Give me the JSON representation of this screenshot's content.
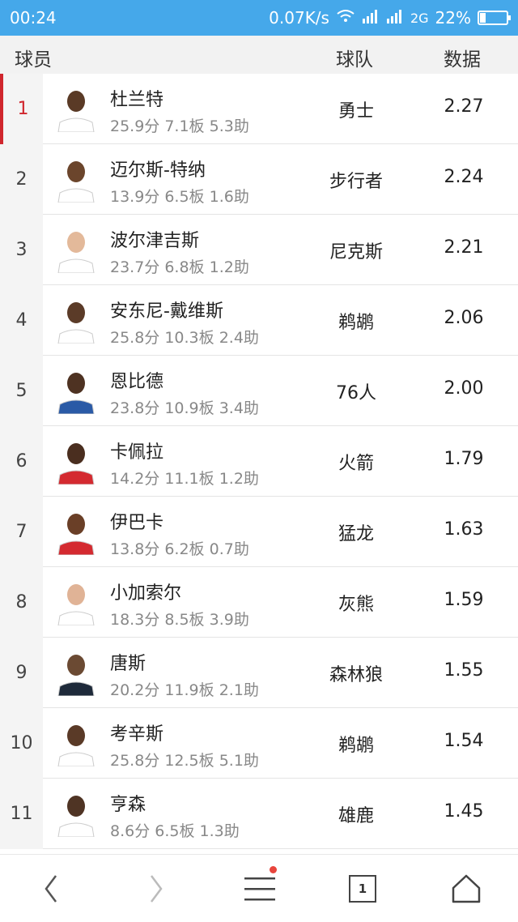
{
  "status": {
    "time": "00:24",
    "speed": "0.07K/s",
    "network": "2G",
    "battery": "22%",
    "battery_level": 0.22
  },
  "header": {
    "player": "球员",
    "team": "球队",
    "value": "数据"
  },
  "rows": [
    {
      "rank": "1",
      "name": "杜兰特",
      "stats": "25.9分 7.1板 5.3助",
      "team": "勇士",
      "value": "2.27",
      "jersey": "#ffffff",
      "skin": "#5a3a26"
    },
    {
      "rank": "2",
      "name": "迈尔斯-特纳",
      "stats": "13.9分 6.5板 1.6助",
      "team": "步行者",
      "value": "2.24",
      "jersey": "#ffffff",
      "skin": "#6b452c"
    },
    {
      "rank": "3",
      "name": "波尔津吉斯",
      "stats": "23.7分 6.8板 1.2助",
      "team": "尼克斯",
      "value": "2.21",
      "jersey": "#ffffff",
      "skin": "#e3b99a"
    },
    {
      "rank": "4",
      "name": "安东尼-戴维斯",
      "stats": "25.8分 10.3板 2.4助",
      "team": "鹈鹕",
      "value": "2.06",
      "jersey": "#ffffff",
      "skin": "#5b3b28"
    },
    {
      "rank": "5",
      "name": "恩比德",
      "stats": "23.8分 10.9板 3.4助",
      "team": "76人",
      "value": "2.00",
      "jersey": "#2a5aa6",
      "skin": "#4e3222"
    },
    {
      "rank": "6",
      "name": "卡佩拉",
      "stats": "14.2分 11.1板 1.2助",
      "team": "火箭",
      "value": "1.79",
      "jersey": "#d42a30",
      "skin": "#4a2e1f"
    },
    {
      "rank": "7",
      "name": "伊巴卡",
      "stats": "13.8分 6.2板 0.7助",
      "team": "猛龙",
      "value": "1.63",
      "jersey": "#d42a30",
      "skin": "#6a3f27"
    },
    {
      "rank": "8",
      "name": "小加索尔",
      "stats": "18.3分 8.5板 3.9助",
      "team": "灰熊",
      "value": "1.59",
      "jersey": "#ffffff",
      "skin": "#e0b396"
    },
    {
      "rank": "9",
      "name": "唐斯",
      "stats": "20.2分 11.9板 2.1助",
      "team": "森林狼",
      "value": "1.55",
      "jersey": "#1e2a3a",
      "skin": "#6b4a33"
    },
    {
      "rank": "10",
      "name": "考辛斯",
      "stats": "25.8分 12.5板 5.1助",
      "team": "鹈鹕",
      "value": "1.54",
      "jersey": "#ffffff",
      "skin": "#5a3a27"
    },
    {
      "rank": "11",
      "name": "亨森",
      "stats": "8.6分 6.5板 1.3助",
      "team": "雄鹿",
      "value": "1.45",
      "jersey": "#ffffff",
      "skin": "#4f3424"
    }
  ],
  "nav": {
    "tab_count": "1"
  },
  "colors": {
    "status_bar": "#45a8ea",
    "active_rank": "#d0262d",
    "notification_dot": "#e8453c"
  }
}
